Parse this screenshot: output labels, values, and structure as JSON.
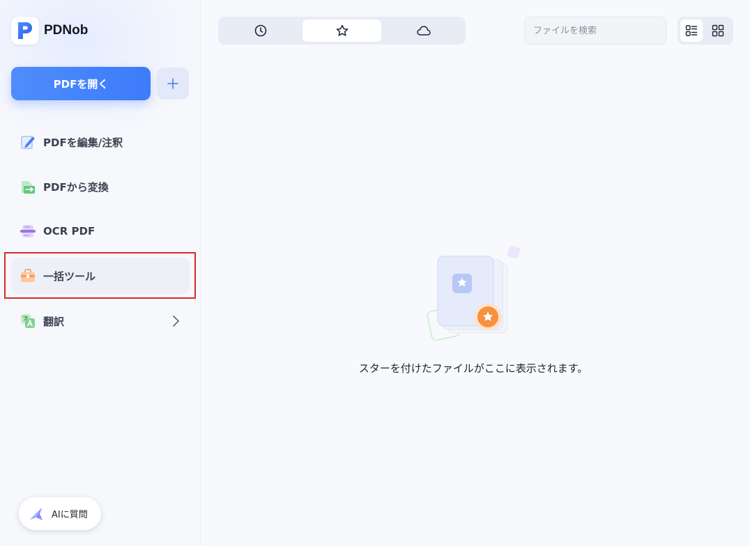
{
  "app": {
    "name": "PDNob"
  },
  "sidebar": {
    "open_pdf_label": "PDFを開く",
    "items": [
      {
        "label": "PDFを編集/注釈",
        "icon": "edit-document-icon"
      },
      {
        "label": "PDFから変換",
        "icon": "convert-document-icon"
      },
      {
        "label": "OCR PDF",
        "icon": "ocr-scan-icon"
      },
      {
        "label": "一括ツール",
        "icon": "toolbox-icon",
        "active": true
      },
      {
        "label": "翻訳",
        "icon": "translate-icon",
        "has_submenu": true
      }
    ],
    "ask_ai_label": "AIに質問"
  },
  "tabs": [
    {
      "name": "recent",
      "icon": "clock-icon"
    },
    {
      "name": "starred",
      "icon": "star-icon",
      "selected": true
    },
    {
      "name": "cloud",
      "icon": "cloud-icon"
    }
  ],
  "search": {
    "placeholder": "ファイルを検索",
    "value": ""
  },
  "view_modes": [
    {
      "name": "list",
      "icon": "list-view-icon",
      "selected": true
    },
    {
      "name": "grid",
      "icon": "grid-view-icon"
    }
  ],
  "main": {
    "empty_message": "スターを付けたファイルがここに表示されます。"
  },
  "colors": {
    "accent": "#3d7bfa",
    "highlight": "#d42a2a",
    "star_badge": "#f7913d"
  }
}
